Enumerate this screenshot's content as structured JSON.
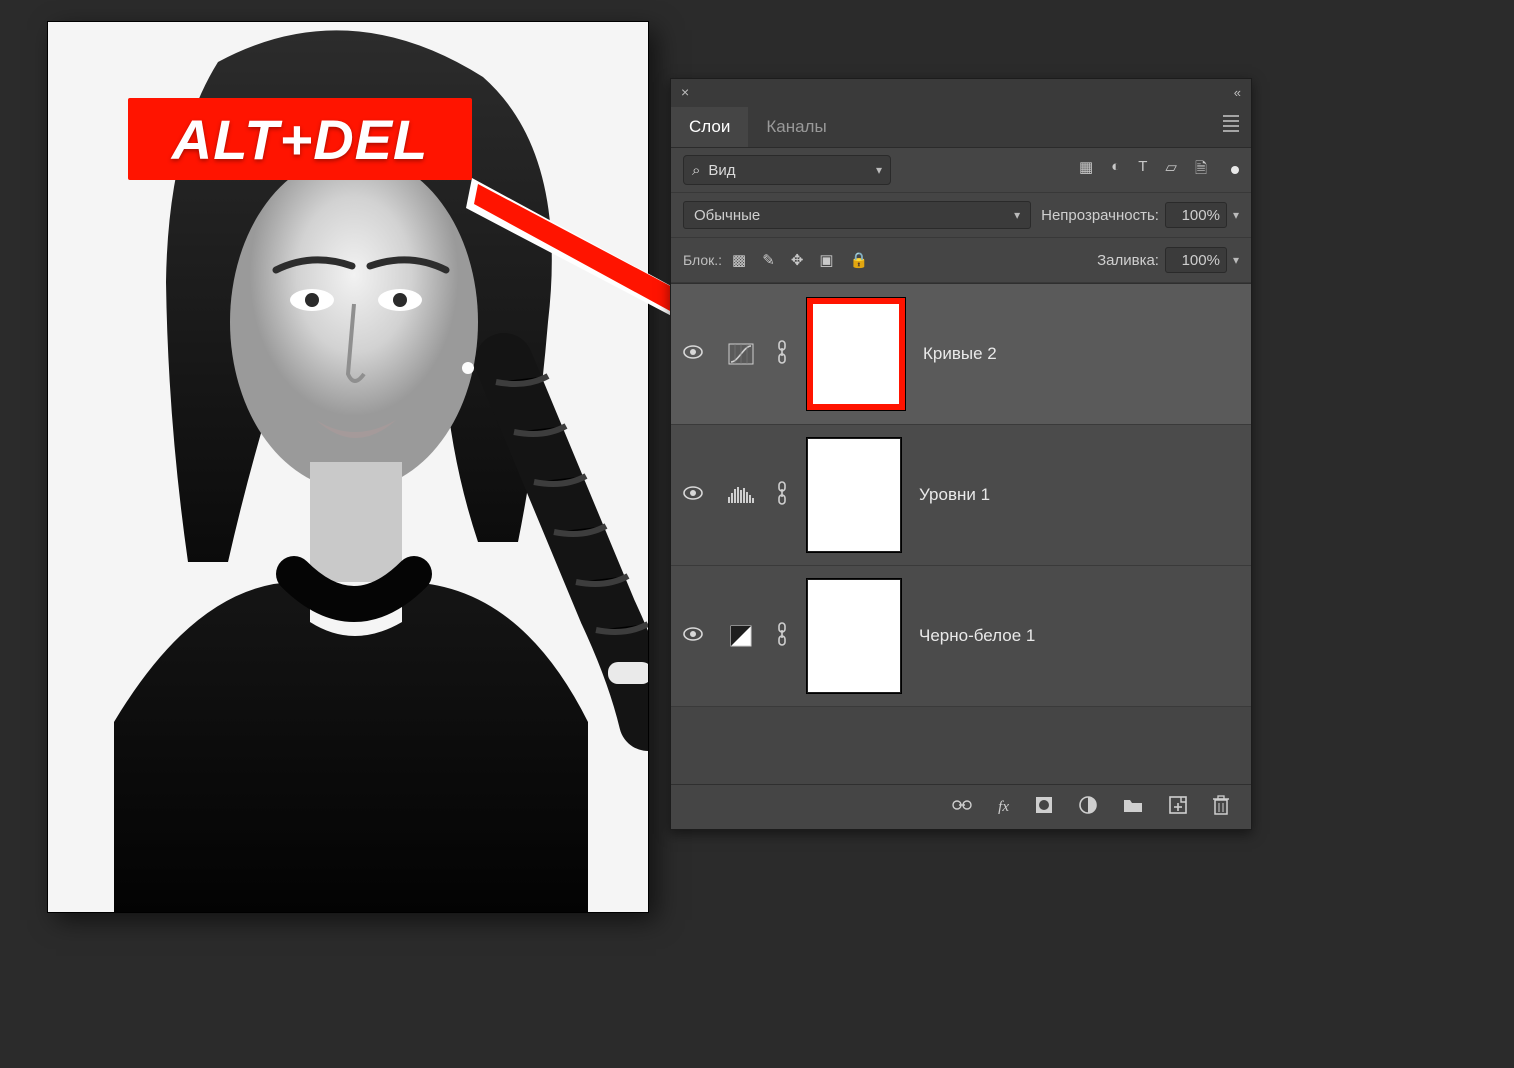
{
  "overlay": {
    "shortcut": "ALT+DEL"
  },
  "panel_title": {
    "close": "×",
    "collapse": "«"
  },
  "tabs": {
    "layers": "Слои",
    "channels": "Каналы",
    "active": "layers"
  },
  "filter": {
    "search_icon": "search-icon",
    "kind_label": "Вид",
    "icons": {
      "pixel": "▦",
      "adjust": "◐",
      "type": "T",
      "shape": "▱",
      "smart": "🗎"
    }
  },
  "blend": {
    "mode_label": "Обычные",
    "opacity_label": "Непрозрачность:",
    "opacity_value": "100%"
  },
  "locks": {
    "icons": {
      "transparency": "▩",
      "brush": "✎",
      "move": "✥",
      "artboard": "▣",
      "all": "🔒"
    },
    "fill_label": "Заливка:",
    "fill_value": "100%"
  },
  "layers": [
    {
      "id": "curves2",
      "visible": true,
      "adj_icon": "curves-icon",
      "link": true,
      "name": "Кривые 2",
      "selected": true,
      "highlight_mask": true
    },
    {
      "id": "levels1",
      "visible": true,
      "adj_icon": "levels-icon",
      "link": true,
      "name": "Уровни 1",
      "selected": false,
      "highlight_mask": false
    },
    {
      "id": "bw1",
      "visible": true,
      "adj_icon": "blackwhite-icon",
      "link": true,
      "name": "Черно-белое 1",
      "selected": false,
      "highlight_mask": false
    }
  ],
  "footer": {
    "link": "⌘",
    "fx": "fx",
    "mask": "◻︎",
    "adjust": "◑",
    "group": "🗀",
    "new": "🗗",
    "trash": "🗑"
  },
  "colors": {
    "accent": "#ff1400",
    "panel_bg": "#454545"
  }
}
